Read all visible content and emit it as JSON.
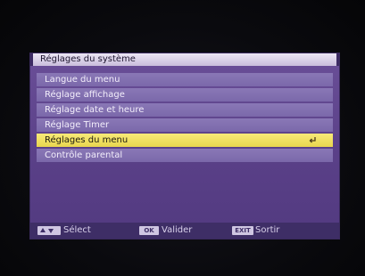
{
  "window": {
    "title": "Réglages du système"
  },
  "menu": {
    "items": [
      {
        "label": "Langue du menu"
      },
      {
        "label": "Réglage affichage"
      },
      {
        "label": "Réglage date et heure"
      },
      {
        "label": "Réglage Timer"
      },
      {
        "label": "Réglages du menu",
        "selected": true
      },
      {
        "label": "Contrôle parental"
      }
    ]
  },
  "footer": {
    "nav_key_icon": "up-down-arrows-icon",
    "select_label": "Sélect",
    "ok_key": "OK",
    "ok_label": "Valider",
    "exit_key": "EXIT",
    "exit_label": "Sortir"
  },
  "colors": {
    "panel": "#5a4088",
    "item": "#7b68aa",
    "selected": "#e9d64e",
    "footer": "#3e2e66"
  }
}
